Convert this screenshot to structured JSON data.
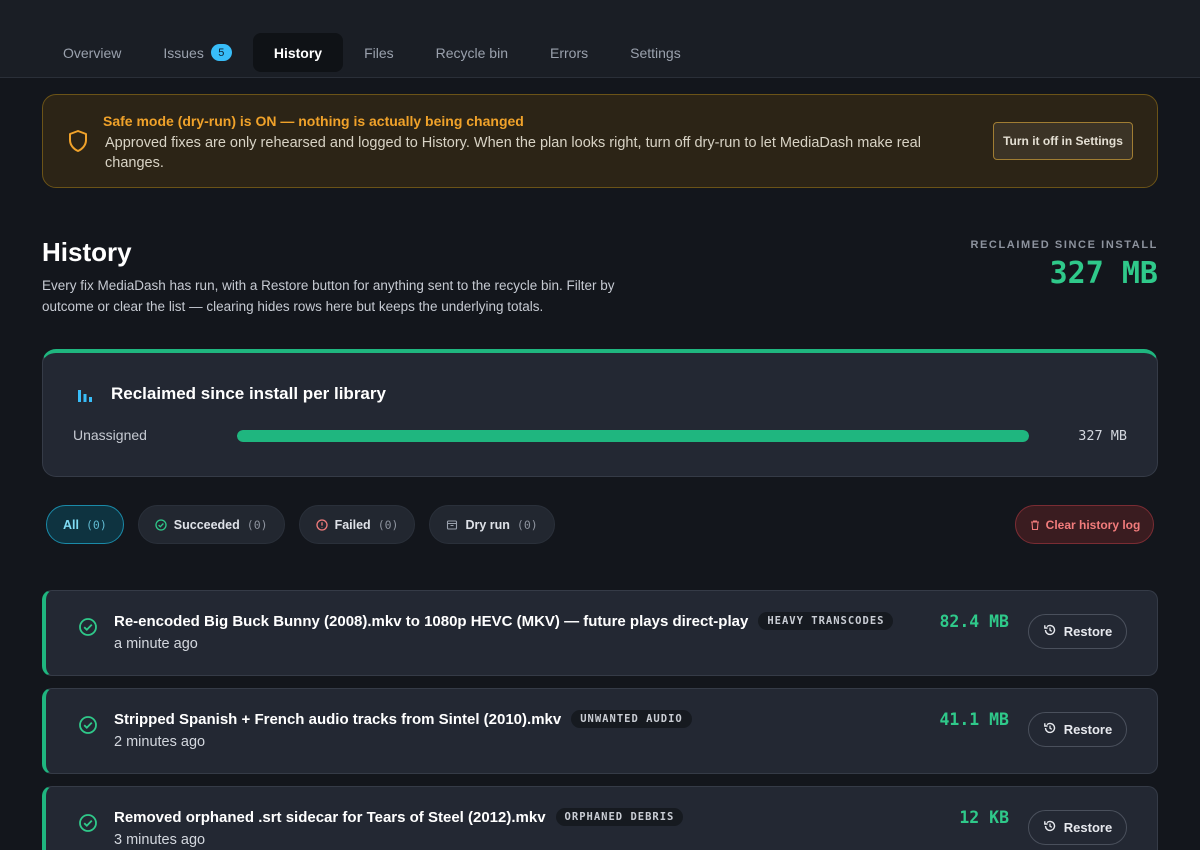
{
  "nav": {
    "tabs": [
      {
        "label": "Overview"
      },
      {
        "label": "Issues",
        "badge": "5"
      },
      {
        "label": "History"
      },
      {
        "label": "Files"
      },
      {
        "label": "Recycle bin"
      },
      {
        "label": "Errors"
      },
      {
        "label": "Settings"
      }
    ],
    "active": "History"
  },
  "banner": {
    "title": "Safe mode (dry-run) is ON — nothing is actually being changed",
    "body": "Approved fixes are only rehearsed and logged to History. When the plan looks right, turn off dry-run to let MediaDash make real changes.",
    "button": "Turn it off in Settings",
    "icon": "shield-icon"
  },
  "header": {
    "title": "History",
    "description": "Every fix MediaDash has run, with a Restore button for anything sent to the recycle bin. Filter by outcome or clear the list — clearing hides rows here but keeps the underlying totals.",
    "reclaimed_label": "RECLAIMED SINCE INSTALL",
    "reclaimed_value": "327 MB"
  },
  "library_card": {
    "title": "Reclaimed since install per library",
    "rows": [
      {
        "label": "Unassigned",
        "value": "327 MB",
        "fraction": 1.0
      }
    ]
  },
  "filters": {
    "chips": [
      {
        "label": "All",
        "count": "(0)",
        "active": true
      },
      {
        "label": "Succeeded",
        "count": "(0)",
        "icon": "check-circle-icon"
      },
      {
        "label": "Failed",
        "count": "(0)",
        "icon": "alert-circle-icon"
      },
      {
        "label": "Dry run",
        "count": "(0)",
        "icon": "archive-icon"
      }
    ],
    "clear_label": "Clear history log"
  },
  "history": {
    "restore_label": "Restore",
    "rows": [
      {
        "description": "Re-encoded Big Buck Bunny (2008).mkv to 1080p HEVC (MKV) — future plays direct-play",
        "tag": "HEAVY TRANSCODES",
        "when": "a minute ago",
        "size": "82.4 MB"
      },
      {
        "description": "Stripped Spanish + French audio tracks from Sintel (2010).mkv",
        "tag": "UNWANTED AUDIO",
        "when": "2 minutes ago",
        "size": "41.1 MB"
      },
      {
        "description": "Removed orphaned .srt sidecar for Tears of Steel (2012).mkv",
        "tag": "ORPHANED DEBRIS",
        "when": "3 minutes ago",
        "size": "12 KB"
      }
    ]
  },
  "colors": {
    "accent_green": "#2fc98a",
    "warning": "#f0a22a",
    "info": "#38bdf8",
    "danger": "#f27c7c"
  }
}
